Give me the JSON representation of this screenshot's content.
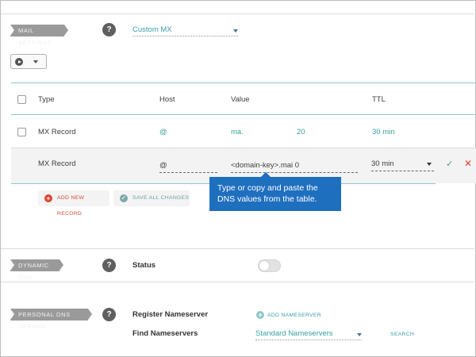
{
  "mail_settings": {
    "tag": "MAIL SETTINGS",
    "help": "?",
    "selected": "Custom MX"
  },
  "table": {
    "headers": {
      "type": "Type",
      "host": "Host",
      "value": "Value",
      "ttl": "TTL"
    },
    "row": {
      "type": "MX Record",
      "host": "@",
      "value": "ma.",
      "priority": "20",
      "ttl": "30 min"
    },
    "edit_row": {
      "type": "MX Record",
      "host": "@",
      "value": "<domain-key>.mai 0",
      "ttl": "30 min"
    },
    "add_new_record": "ADD NEW RECORD",
    "save_all_changes": "SAVE ALL CHANGES"
  },
  "tooltip": {
    "line1": "Type or copy and paste the",
    "line2": "DNS values from the table."
  },
  "dynamic_dns": {
    "tag": "DYNAMIC DNS",
    "help": "?",
    "status_label": "Status"
  },
  "personal_dns": {
    "tag": "PERSONAL DNS SERVER",
    "help": "?",
    "register_label": "Register Nameserver",
    "add_nameserver": "ADD NAMESERVER",
    "find_label": "Find Nameservers",
    "find_selected": "Standard Nameservers",
    "search": "SEARCH"
  },
  "colors": {
    "teal": "#3aa0a0",
    "tooltip_blue": "#1f6fbf",
    "danger_red": "#e2402d",
    "tag_gray": "#9a9a9a"
  }
}
